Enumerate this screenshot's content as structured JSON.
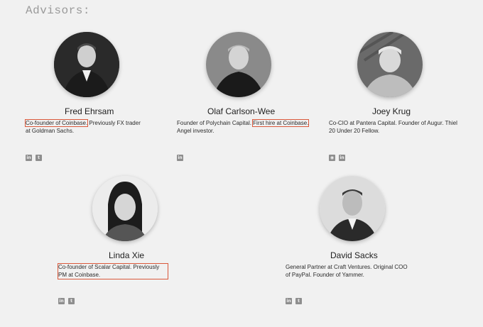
{
  "section": {
    "title": "Advisors:"
  },
  "advisors": [
    {
      "name": "Fred Ehrsam",
      "bio_highlight": "Co-founder of Coinbase.",
      "bio_rest": " Previously FX trader at Goldman Sachs.",
      "socials": [
        "linkedin-icon",
        "twitter-icon"
      ]
    },
    {
      "name": "Olaf Carlson-Wee",
      "bio_pre": "Founder of Polychain Capital. ",
      "bio_highlight": "First hire at Coinbase.",
      "bio_rest": " Angel investor.",
      "socials": [
        "linkedin-icon"
      ]
    },
    {
      "name": "Joey Krug",
      "bio": "Co-CIO at Pantera Capital. Founder of Augur. Thiel 20 Under 20 Fellow.",
      "socials": [
        "github-icon",
        "linkedin-icon"
      ]
    },
    {
      "name": "Linda Xie",
      "bio_highlight": "Co-founder of Scalar Capital. Previously PM at Coinbase.",
      "socials": [
        "linkedin-icon",
        "twitter-icon"
      ]
    },
    {
      "name": "David Sacks",
      "bio": "General Partner at Craft Ventures. Original COO of PayPal. Founder of Yammer.",
      "socials": [
        "linkedin-icon",
        "twitter-icon"
      ]
    }
  ],
  "colors": {
    "background": "#f1f1f1",
    "title": "#9a9a9a",
    "highlight_box": "#d9583b",
    "icon": "#8e8e8e"
  }
}
